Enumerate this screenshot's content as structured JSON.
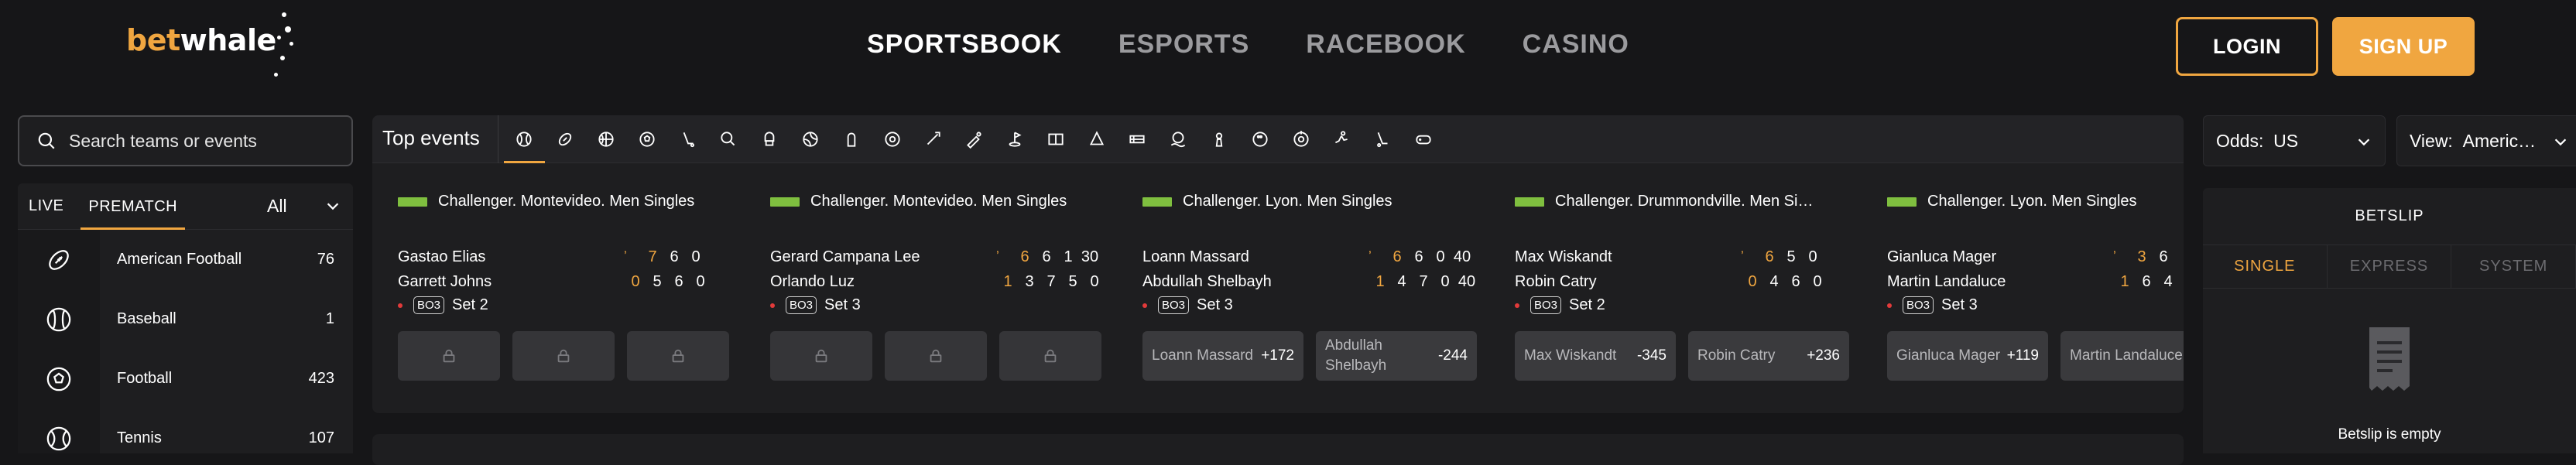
{
  "brand": {
    "part1": "bet",
    "part2": "whale"
  },
  "nav": {
    "items": [
      {
        "label": "SPORTSBOOK",
        "active": true
      },
      {
        "label": "ESPORTS",
        "active": false
      },
      {
        "label": "RACEBOOK",
        "active": false
      },
      {
        "label": "CASINO",
        "active": false
      }
    ]
  },
  "auth": {
    "login": "LOGIN",
    "signup": "SIGN UP"
  },
  "search": {
    "placeholder": "Search teams or events"
  },
  "left_panel": {
    "tab_live": "LIVE",
    "tab_prematch": "PREMATCH",
    "filter": "All",
    "sports": [
      {
        "name": "American Football",
        "count": "76",
        "icon": "american-football-icon"
      },
      {
        "name": "Baseball",
        "count": "1",
        "icon": "baseball-icon"
      },
      {
        "name": "Football",
        "count": "423",
        "icon": "football-icon"
      },
      {
        "name": "Tennis",
        "count": "107",
        "icon": "tennis-icon"
      }
    ]
  },
  "top_events": {
    "label": "Top events",
    "sport_tabs": [
      "tennis-icon",
      "american-football-icon",
      "basketball-icon",
      "soccer-icon",
      "hockey-icon",
      "table-tennis-icon",
      "boxing-icon",
      "volleyball-icon",
      "handball-icon",
      "rugby-icon",
      "darts-icon",
      "cricket-icon",
      "golf-icon",
      "futsal-icon",
      "badminton-icon",
      "snooker-icon",
      "water-polo-icon",
      "chess-icon",
      "bowling-icon",
      "shooting-icon",
      "athletics-icon",
      "floorball-icon",
      "esports-icon"
    ]
  },
  "events": [
    {
      "tournament": "Challenger. Montevideo. Men Singles",
      "players": [
        {
          "name": "Gastao Elias",
          "serving": true,
          "scores": [
            "7",
            "6",
            "0"
          ]
        },
        {
          "name": "Garrett Johns",
          "serving": false,
          "scores": [
            "0",
            "5",
            "6",
            "0"
          ]
        }
      ],
      "format": "BO3",
      "status": "Set 2",
      "odds": []
    },
    {
      "tournament": "Challenger. Montevideo. Men Singles",
      "players": [
        {
          "name": "Gerard Campana Lee",
          "serving": true,
          "scores": [
            "6",
            "6",
            "1",
            "30"
          ]
        },
        {
          "name": "Orlando Luz",
          "serving": false,
          "scores": [
            "1",
            "3",
            "7",
            "5",
            "0"
          ]
        }
      ],
      "format": "BO3",
      "status": "Set 3",
      "odds": []
    },
    {
      "tournament": "Challenger. Lyon. Men Singles",
      "players": [
        {
          "name": "Loann Massard",
          "serving": true,
          "scores": [
            "6",
            "6",
            "0",
            "40"
          ]
        },
        {
          "name": "Abdullah Shelbayh",
          "serving": false,
          "scores": [
            "1",
            "4",
            "7",
            "0",
            "40"
          ]
        }
      ],
      "format": "BO3",
      "status": "Set 3",
      "odds": [
        {
          "name": "Loann Massard",
          "value": "+172"
        },
        {
          "name": "Abdullah Shelbayh",
          "value": "-244"
        }
      ]
    },
    {
      "tournament": "Challenger. Drummondville. Men Si…",
      "players": [
        {
          "name": "Max Wiskandt",
          "serving": true,
          "scores": [
            "6",
            "5",
            "0"
          ]
        },
        {
          "name": "Robin Catry",
          "serving": false,
          "scores": [
            "0",
            "4",
            "6",
            "0"
          ]
        }
      ],
      "format": "BO3",
      "status": "Set 2",
      "odds": [
        {
          "name": "Max Wiskandt",
          "value": "-345"
        },
        {
          "name": "Robin Catry",
          "value": "+236"
        }
      ]
    },
    {
      "tournament": "Challenger. Lyon. Men Singles",
      "players": [
        {
          "name": "Gianluca Mager",
          "serving": true,
          "scores": [
            "3",
            "6"
          ]
        },
        {
          "name": "Martin Landaluce",
          "serving": false,
          "scores": [
            "1",
            "6",
            "4"
          ]
        }
      ],
      "format": "BO3",
      "status": "Set 3",
      "odds": [
        {
          "name": "Gianluca Mager",
          "value": "+119"
        },
        {
          "name": "Martin Landaluce",
          "value": ""
        }
      ]
    }
  ],
  "odds_format": {
    "label": "Odds:",
    "value": "US"
  },
  "view": {
    "label": "View:",
    "value": "Americ…"
  },
  "betslip": {
    "title": "BETSLIP",
    "tabs": [
      {
        "label": "SINGLE",
        "active": true
      },
      {
        "label": "EXPRESS",
        "active": false
      },
      {
        "label": "SYSTEM",
        "active": false
      }
    ],
    "empty": "Betslip is empty"
  },
  "colors": {
    "accent": "#f0a640",
    "background": "#161618",
    "panel": "#1e1e20",
    "live": "#e23a3a",
    "flag": "#7fbf3f"
  }
}
